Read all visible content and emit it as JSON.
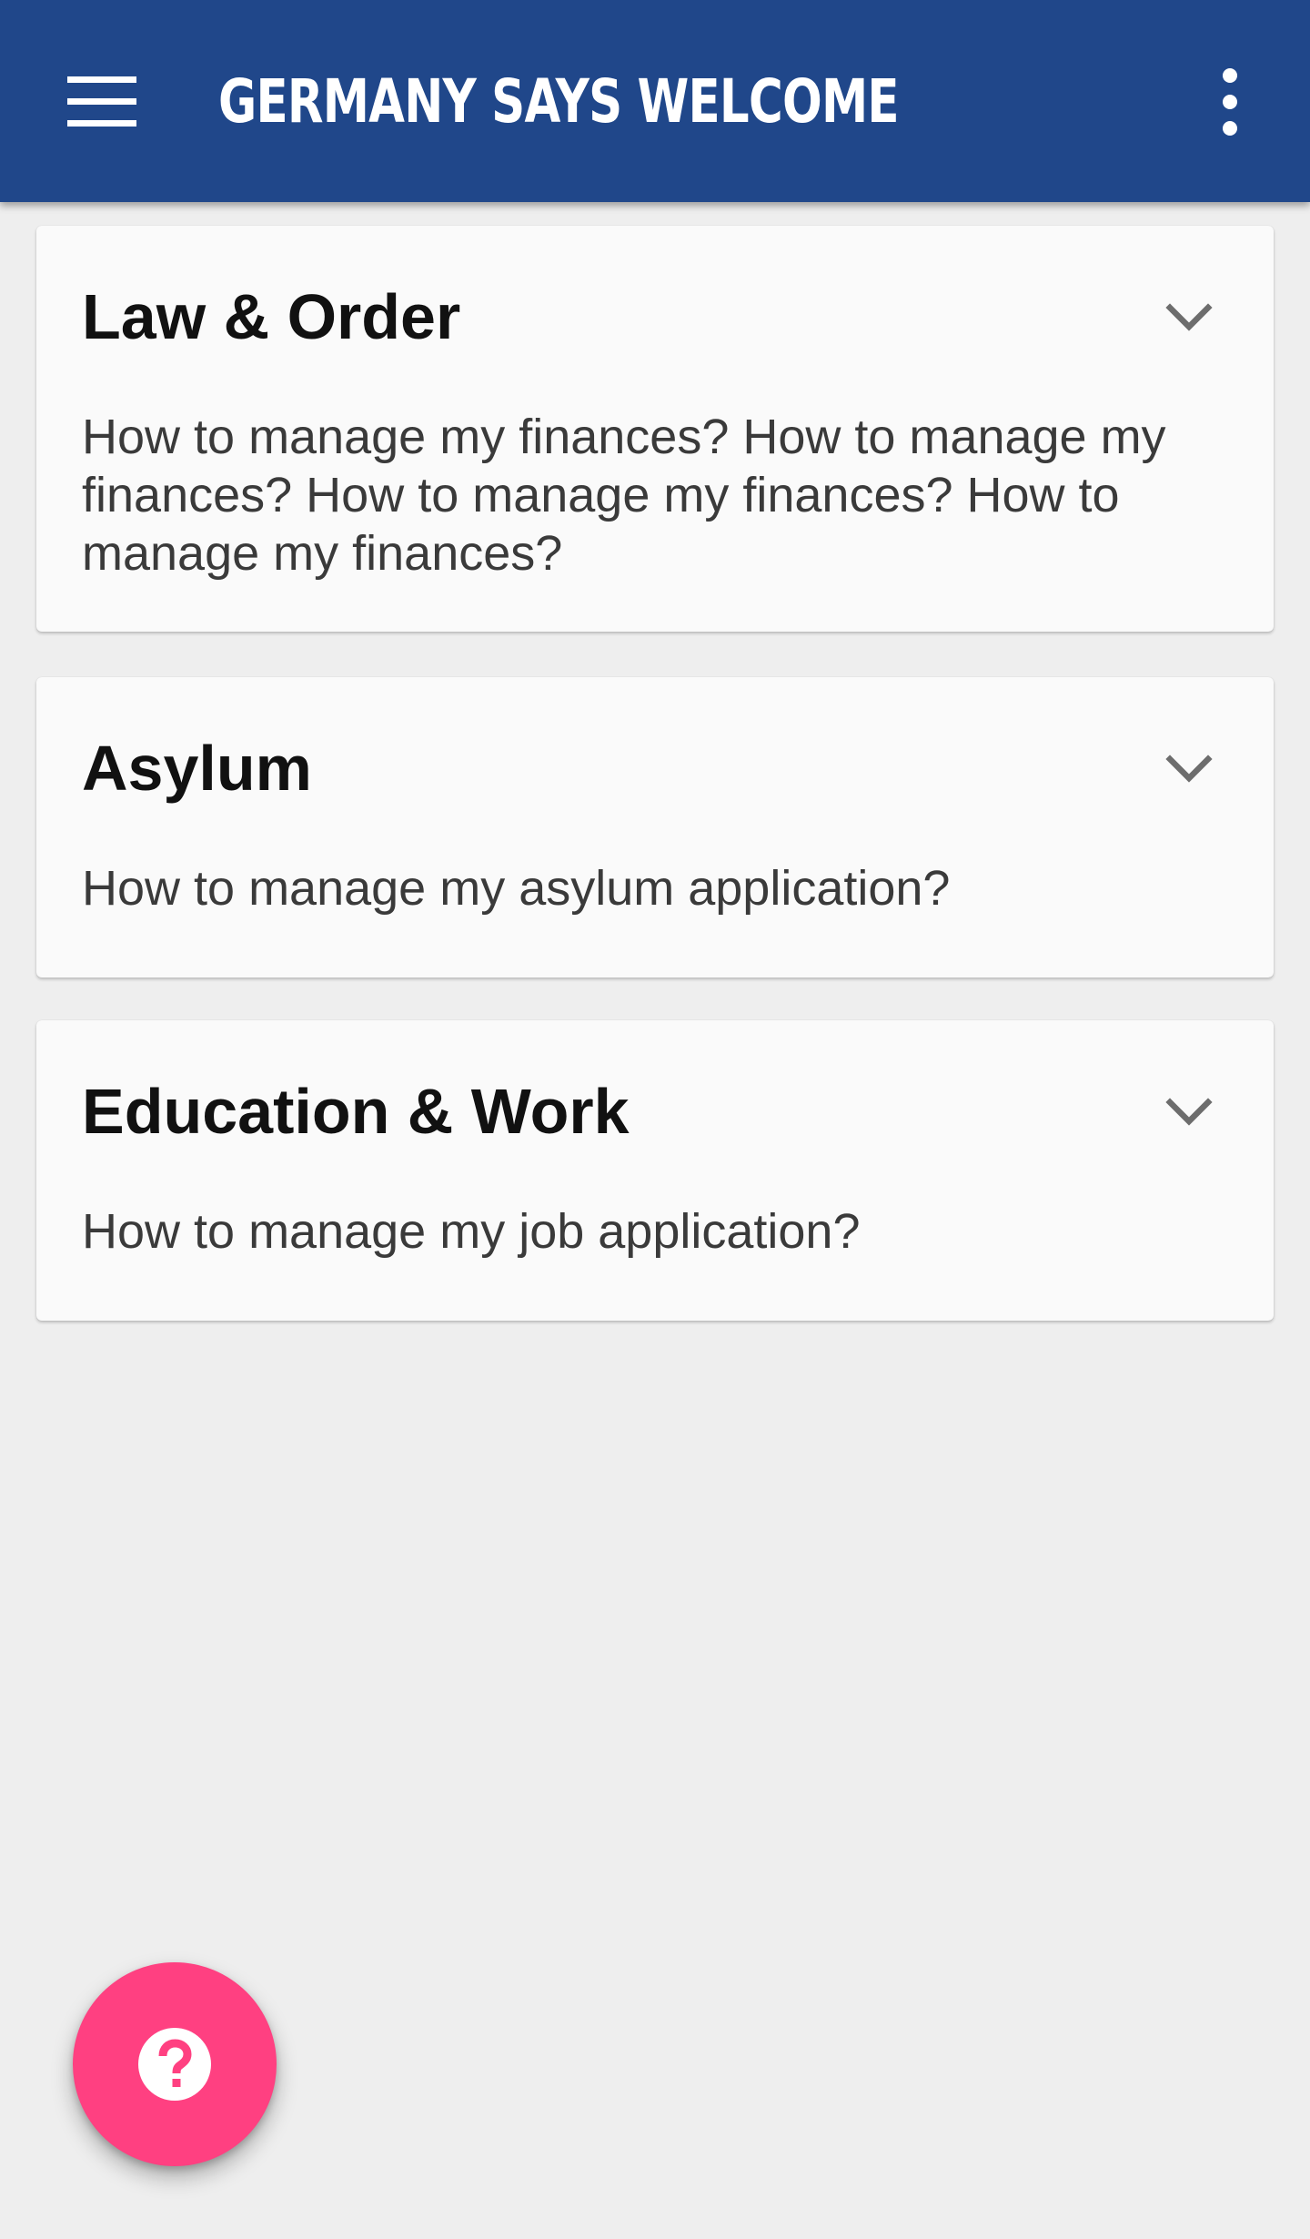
{
  "app_bar": {
    "title": "GERMANY SAYS WELCOME",
    "background_color": "#20478a",
    "menu_icon": "hamburger-menu-icon",
    "overflow_icon": "more-vertical-icon"
  },
  "cards": [
    {
      "title": "Law & Order",
      "description": "How to manage my finances? How to manage my finances? How to manage my finances? How to manage my finances?",
      "icon": "chevron-down-icon"
    },
    {
      "title": "Asylum",
      "description": "How to manage my asylum application?",
      "icon": "chevron-down-icon"
    },
    {
      "title": "Education & Work",
      "description": "How to manage my job application?",
      "icon": "chevron-down-icon"
    }
  ],
  "fab": {
    "icon": "help-question-icon",
    "color": "#ff4081"
  },
  "colors": {
    "page_background": "#eeeeee",
    "card_background": "#fafafa",
    "chevron": "#6d6d6d"
  }
}
